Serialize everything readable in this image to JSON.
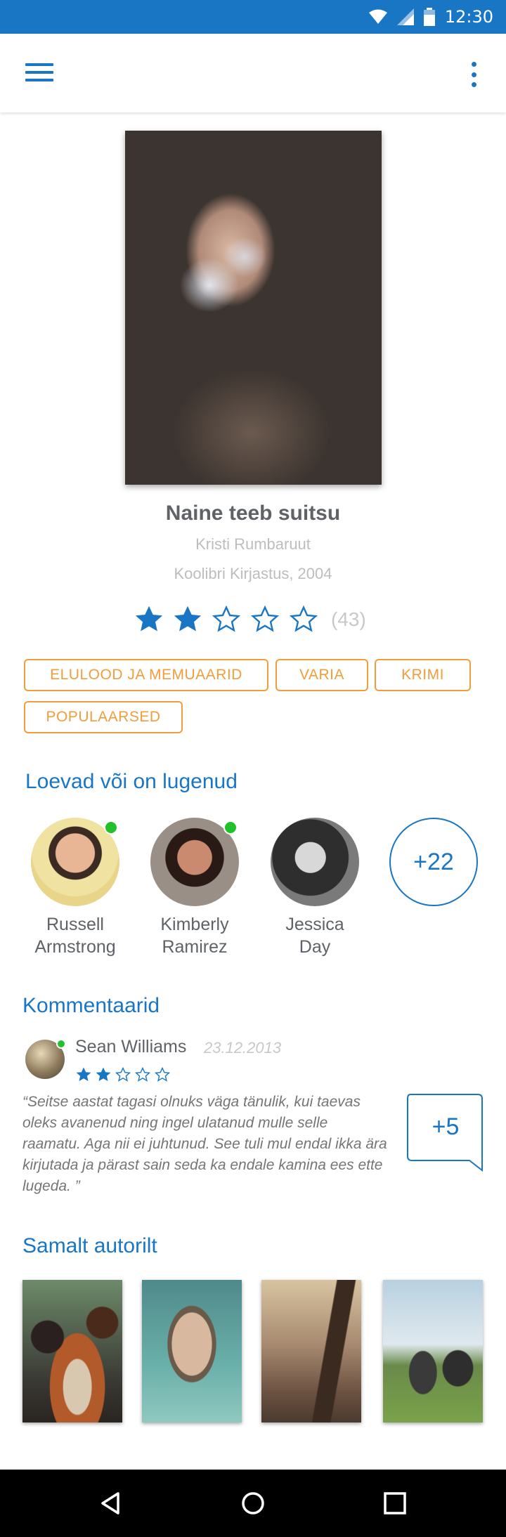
{
  "status_bar": {
    "time": "12:30"
  },
  "book": {
    "title": "Naine teeb suitsu",
    "author": "Kristi Rumbaruut",
    "publisher": "Koolibri Kirjastus, 2004",
    "rating": 2,
    "rating_max": 5,
    "rating_count": "(43)"
  },
  "tags": [
    "ELULOOD JA MEMUAARID",
    "VARIA",
    "KRIMI",
    "POPULAARSED"
  ],
  "readers_section": {
    "title": "Loevad või on lugenud",
    "readers": [
      {
        "first": "Russell",
        "last": "Armstrong",
        "online": true
      },
      {
        "first": "Kimberly",
        "last": "Ramirez",
        "online": true
      },
      {
        "first": "Jessica",
        "last": "Day",
        "online": false
      }
    ],
    "more": "+22"
  },
  "comments_section": {
    "title": "Kommentaarid",
    "comment": {
      "author": "Sean Williams",
      "date": "23.12.2013",
      "rating": 2,
      "text": "“Seitse aastat tagasi olnuks väga tänulik, kui taevas oleks avanenud ning ingel ulatanud mulle selle raamatu. Aga nii ei juhtunud. See tuli mul endal ikka ära kirjutada ja pärast sain seda ka endale kamina ees ette lugeda. ”"
    },
    "more": "+5"
  },
  "same_author_section": {
    "title": "Samalt autorilt"
  },
  "colors": {
    "primary": "#1976c5",
    "accent": "#f29d3c",
    "online": "#22c12b"
  }
}
